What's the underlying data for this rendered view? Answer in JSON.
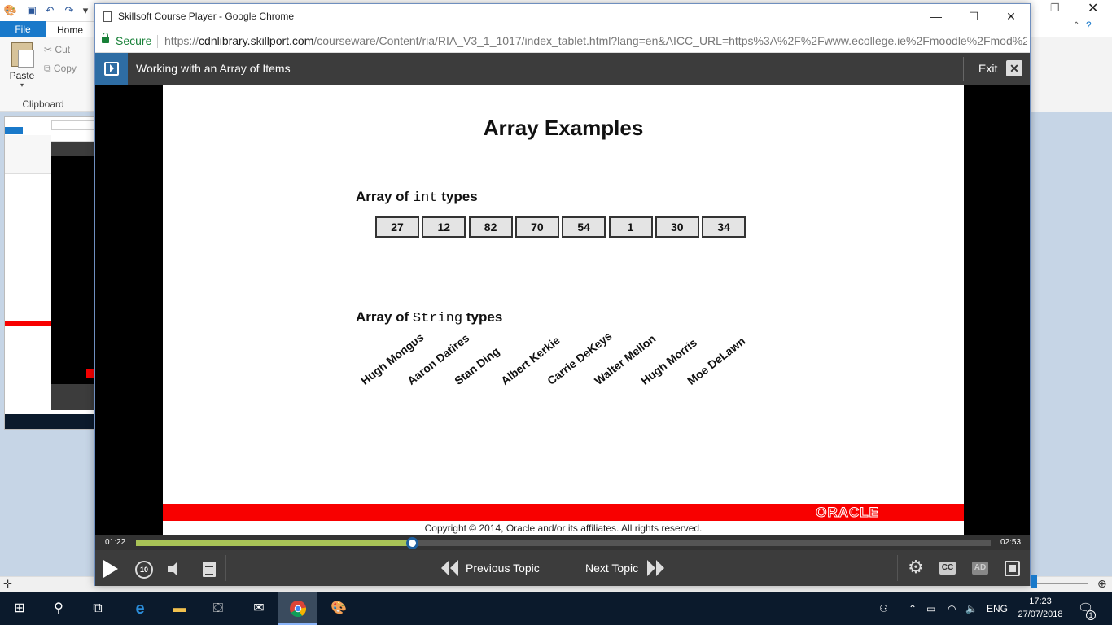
{
  "background_app": {
    "tabs": {
      "file": "File",
      "home": "Home"
    },
    "clipboard": {
      "paste": "Paste",
      "cut": "Cut",
      "copy": "Copy",
      "group_label": "Clipboard"
    }
  },
  "chrome": {
    "title": "Skillsoft Course Player - Google Chrome",
    "secure_label": "Secure",
    "url_scheme": "https://",
    "url_host": "cdnlibrary.skillport.com",
    "url_rest": "/courseware/Content/ria/RIA_V3_1_1017/index_tablet.html?lang=en&AICC_URL=https%3A%2F%2Fwww.ecollege.ie%2Fmoodle%2Fmod%2..."
  },
  "player": {
    "lesson_title": "Working with an Array of Items",
    "exit_label": "Exit",
    "time_elapsed": "01:22",
    "time_total": "02:53",
    "progress_fraction": 0.323,
    "rewind_label": "10",
    "prev_topic": "Previous Topic",
    "next_topic": "Next Topic",
    "cc_label": "CC",
    "ad_label": "AD"
  },
  "slide": {
    "title": "Array Examples",
    "int_heading": {
      "pre": "Array of ",
      "code": "int",
      "post": " types"
    },
    "int_values": [
      "27",
      "12",
      "82",
      "70",
      "54",
      "1",
      "30",
      "34"
    ],
    "string_heading": {
      "pre": "Array of ",
      "code": "String",
      "post": " types"
    },
    "string_values": [
      "Hugh Mongus",
      "Aaron Datires",
      "Stan Ding",
      "Albert Kerkie",
      "Carrie DeKeys",
      "Walter Mellon",
      "Hugh Morris",
      "Moe DeLawn"
    ],
    "logo": "ORACLE",
    "copyright": "Copyright © 2014, Oracle and/or its affiliates. All rights reserved."
  },
  "taskbar": {
    "language": "ENG",
    "time": "17:23",
    "date": "27/07/2018",
    "notification_count": "1"
  }
}
